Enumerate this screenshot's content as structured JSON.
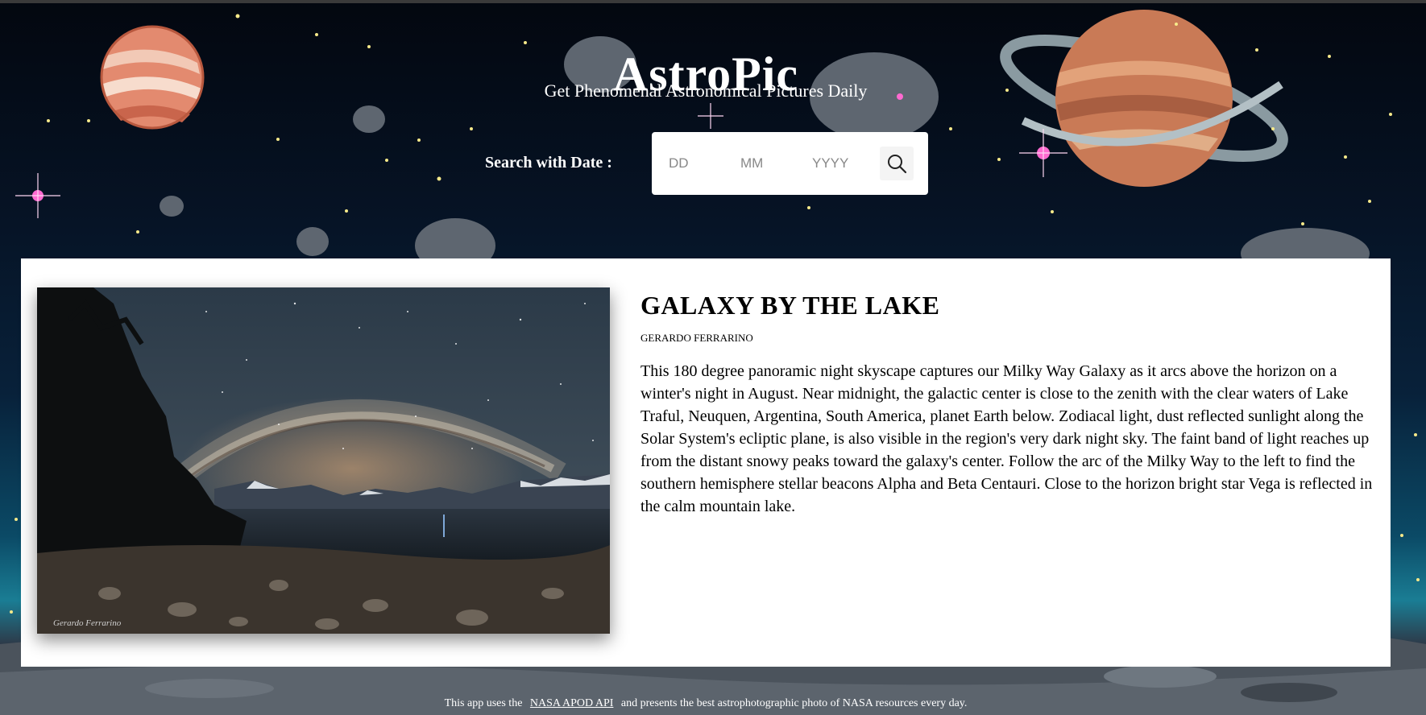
{
  "app": {
    "title": "AstroPic",
    "subtitle": "Get Phenomenal Astronomical Pictures Daily"
  },
  "search": {
    "label": "Search with Date :",
    "day_placeholder": "DD",
    "month_placeholder": "MM",
    "year_placeholder": "YYYY",
    "day_value": "",
    "month_value": "",
    "year_value": "",
    "button_icon": "search-icon"
  },
  "picture": {
    "title": "GALAXY BY THE LAKE",
    "author": "GERARDO FERRARINO",
    "description": "This 180 degree panoramic night skyscape captures our Milky Way Galaxy as it arcs above the horizon on a winter's night in August. Near midnight, the galactic center is close to the zenith with the clear waters of Lake Traful, Neuquen, Argentina, South America, planet Earth below. Zodiacal light, dust reflected sunlight along the Solar System's ecliptic plane, is also visible in the region's very dark night sky. The faint band of light reaches up from the distant snowy peaks toward the galaxy's center. Follow the arc of the Milky Way to the left to find the southern hemisphere stellar beacons Alpha and Beta Centauri. Close to the horizon bright star Vega is reflected in the calm mountain lake.",
    "watermark": "Gerardo Ferrarino"
  },
  "footer": {
    "prefix": "This app uses the",
    "link_text": "NASA APOD API",
    "suffix": "and presents the best astrophotographic photo of NASA resources every day."
  },
  "colors": {
    "sky_dark": "#03070f",
    "sky_teal": "#1a7d94",
    "card_bg": "#ffffff",
    "text_white": "#ffffff"
  }
}
